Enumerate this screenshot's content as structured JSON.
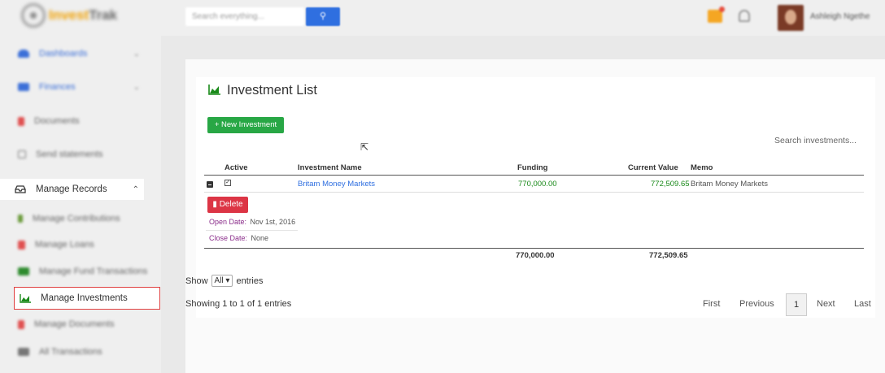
{
  "app": {
    "logo_text_a": "Invest",
    "logo_text_b": "Trak"
  },
  "topbar": {
    "search_placeholder": "Search everything...",
    "user_name": "Ashleigh Ngethe",
    "accent": "#2f6fe0"
  },
  "sidebar": {
    "items": [
      {
        "label": "Dashboards"
      },
      {
        "label": "Finances"
      },
      {
        "label": "Documents"
      },
      {
        "label": "Send statements"
      },
      {
        "label": "Manage Records"
      },
      {
        "label": "Manage Contributions"
      },
      {
        "label": "Manage Loans"
      },
      {
        "label": "Manage Fund Transactions"
      },
      {
        "label": "Manage Investments"
      },
      {
        "label": "Manage Documents"
      },
      {
        "label": "All Transactions"
      }
    ]
  },
  "page": {
    "title": "Investment List",
    "new_button": "+ New Investment",
    "search_placeholder": "Search investments..."
  },
  "table": {
    "headers": {
      "active": "Active",
      "name": "Investment Name",
      "funding": "Funding",
      "current": "Current Value",
      "memo": "Memo"
    },
    "rows": [
      {
        "name": "Britam Money Markets",
        "funding": "770,000.00",
        "current": "772,509.65",
        "memo": "Britam Money Markets",
        "active": true
      }
    ],
    "delete_button": "Delete",
    "open_label": "Open Date:",
    "open_value": "Nov 1st, 2016",
    "close_label": "Close Date:",
    "close_value": "None",
    "total_funding": "770,000.00",
    "total_current": "772,509.65"
  },
  "footer": {
    "show_prefix": "Show",
    "show_value": "All",
    "show_suffix": "entries",
    "info": "Showing 1 to 1 of 1 entries",
    "first": "First",
    "previous": "Previous",
    "page": "1",
    "next": "Next",
    "last": "Last"
  }
}
